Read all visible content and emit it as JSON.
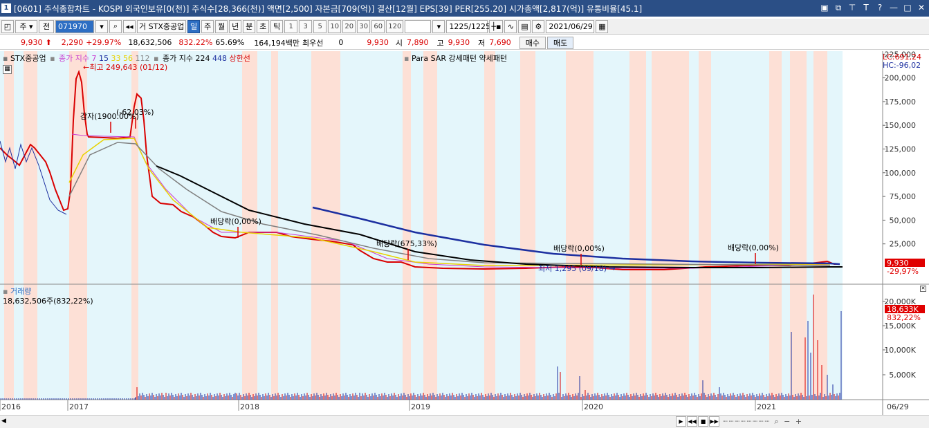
{
  "window": {
    "number": "1",
    "title": "[0601] 주식종합차트 - KOSPI 외국인보유[0(천)] 주식수[28,366(천)] 액면[2,500] 자본금[709(억)] 결산[12월] EPS[39] PER[255.20] 시가총액[2,817(억)] 유통비율[45.1]"
  },
  "toolbar": {
    "period_select": "주",
    "jeon": "전",
    "code": "071970",
    "name_prefix": "거",
    "name": "STX중공업",
    "periods": [
      "일",
      "주",
      "월",
      "년",
      "분",
      "초",
      "틱"
    ],
    "active_period": "일",
    "intervals": [
      "1",
      "3",
      "5",
      "10",
      "20",
      "30",
      "60",
      "120"
    ],
    "count": "1225/1225",
    "date": "2021/06/29"
  },
  "quote": {
    "price": "9,930",
    "change": "2,290",
    "change_pct": "+29.97%",
    "volume": "18,632,506",
    "volume_pct": "832.22%",
    "turnover": "65.69%",
    "amount": "164,194백만",
    "best_label": "최우선",
    "best_qty": "0",
    "best_price": "9,930",
    "open_label": "시",
    "open": "7,890",
    "high_label": "고",
    "high": "9,930",
    "low_label": "저",
    "low": "7,690",
    "buy_label": "매수",
    "sell_label": "매도"
  },
  "legend": {
    "stock": "STX중공업",
    "ma_label": "종가 지수",
    "ma_periods": [
      "7",
      "15",
      "33",
      "56",
      "112"
    ],
    "ma2_label": "종가 지수 224",
    "ma2_period": "448",
    "limit_label": "상한선",
    "psar_label": "Para SAR 강세패턴",
    "weak_label": "약세패턴",
    "volume_label": "거래량",
    "volume_value": "18,632,506주(832,22%)",
    "lc": "LC:691,24",
    "hc": "HC:-96,02"
  },
  "annotations": {
    "high_mark": "최고 249,643 (01/12)",
    "reduction": "감자(1900.00%)",
    "change_mark": "(-62.03%)",
    "div1": "배당락(0,00%)",
    "div2": "배당락(675,33%)",
    "div3": "배당락(0,00%)",
    "div4": "배당락(0,00%)",
    "low_mark": "최저 1,295 (09/18)"
  },
  "price_axis": {
    "ticks": [
      "225,000",
      "200,000",
      "175,000",
      "150,000",
      "125,000",
      "100,000",
      "75,000",
      "50,000",
      "25,000"
    ],
    "current_price": "9,930",
    "current_pct": "29,97%"
  },
  "volume_axis": {
    "ticks": [
      "20,000K",
      "15,000K",
      "10,000K",
      "5,000K"
    ],
    "current_vol": "18,633K",
    "current_pct": "832,22%"
  },
  "time_axis": {
    "labels": [
      "2016",
      "2017",
      "2018",
      "2019",
      "2020",
      "2021"
    ],
    "end_label": "06/29"
  },
  "colors": {
    "titlebar": "#2b4f86",
    "bull_bg": "#e4f6fb",
    "bear_bg": "#fde0d6",
    "price_red": "#d90000",
    "ma_long": "#000000",
    "ma_448": "#1c2fa0"
  }
}
